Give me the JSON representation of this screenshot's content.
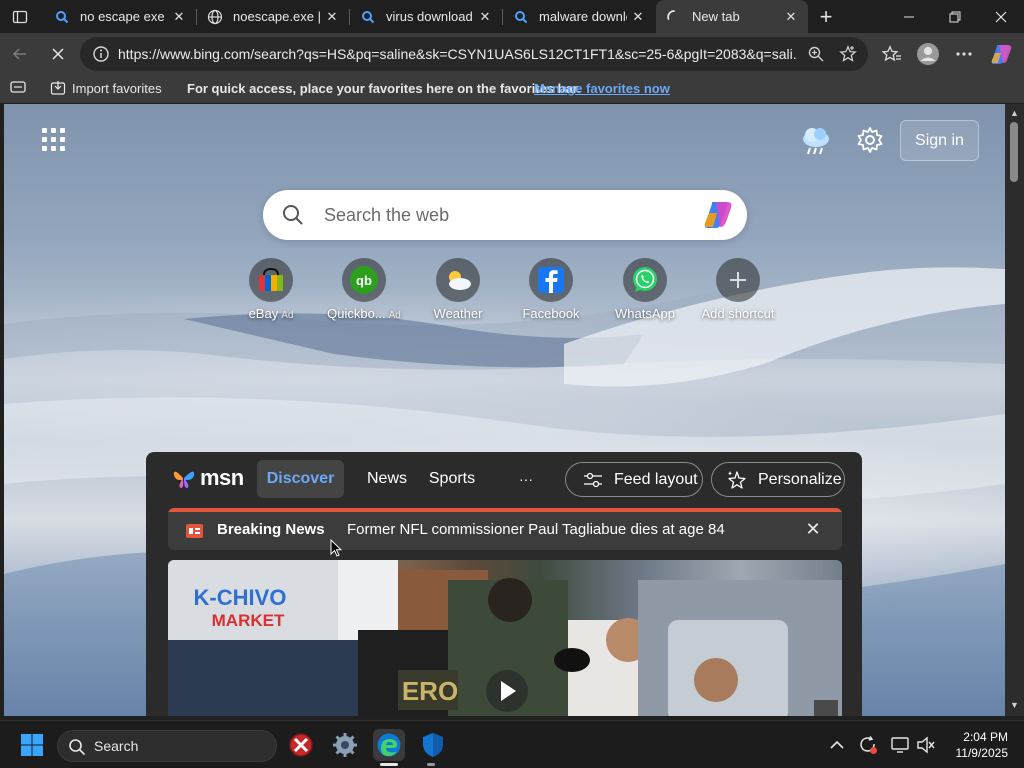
{
  "browser": {
    "tabs": [
      {
        "title": "no escape exe do",
        "icon": "bing-search-icon",
        "active": false
      },
      {
        "title": "noescape.exe | Sh",
        "icon": "globe-icon",
        "active": false
      },
      {
        "title": "virus download -",
        "icon": "bing-search-icon",
        "active": false
      },
      {
        "title": "malware downloa",
        "icon": "bing-search-icon",
        "active": false
      },
      {
        "title": "New tab",
        "icon": "loading-spinner-icon",
        "active": true
      }
    ],
    "address": {
      "url": "https://www.bing.com/search?qs=HS&pq=saline&sk=CSYN1UAS6LS12CT1FT1&sc=25-6&pgIt=2083&q=sali..."
    },
    "favorites_bar": {
      "import_label": "Import favorites",
      "hint": "For quick access, place your favorites here on the favorites bar.",
      "manage_link": "Manage favorites now"
    }
  },
  "page": {
    "sign_in": "Sign in",
    "search_placeholder": "Search the web",
    "shortcuts": [
      {
        "label": "eBay",
        "ad": "Ad",
        "icon": "ebay-icon"
      },
      {
        "label": "Quickbo...",
        "ad": "Ad",
        "icon": "quickbooks-icon"
      },
      {
        "label": "Weather",
        "ad": "",
        "icon": "weather-icon"
      },
      {
        "label": "Facebook",
        "ad": "",
        "icon": "facebook-icon"
      },
      {
        "label": "WhatsApp",
        "ad": "",
        "icon": "whatsapp-icon"
      },
      {
        "label": "Add shortcut",
        "ad": "",
        "icon": "plus-icon"
      }
    ],
    "msn": {
      "logo": "msn",
      "nav": [
        "Discover",
        "News",
        "Sports",
        "···"
      ],
      "feed_layout": "Feed layout",
      "personalize": "Personalize",
      "breaking": {
        "label": "Breaking News",
        "headline": "Former NFL commissioner Paul Tagliabue dies at age 84"
      },
      "image_text": {
        "sign": "K-CHIVO",
        "sign2": "MARKET",
        "vest": "ERO"
      }
    }
  },
  "taskbar": {
    "search_label": "Search",
    "time": "2:04 PM",
    "date": "11/9/2025"
  },
  "colors": {
    "accent_blue": "#6ca9f6",
    "breaking_red": "#e0553b",
    "edge_blue": "#0a7bd6"
  }
}
